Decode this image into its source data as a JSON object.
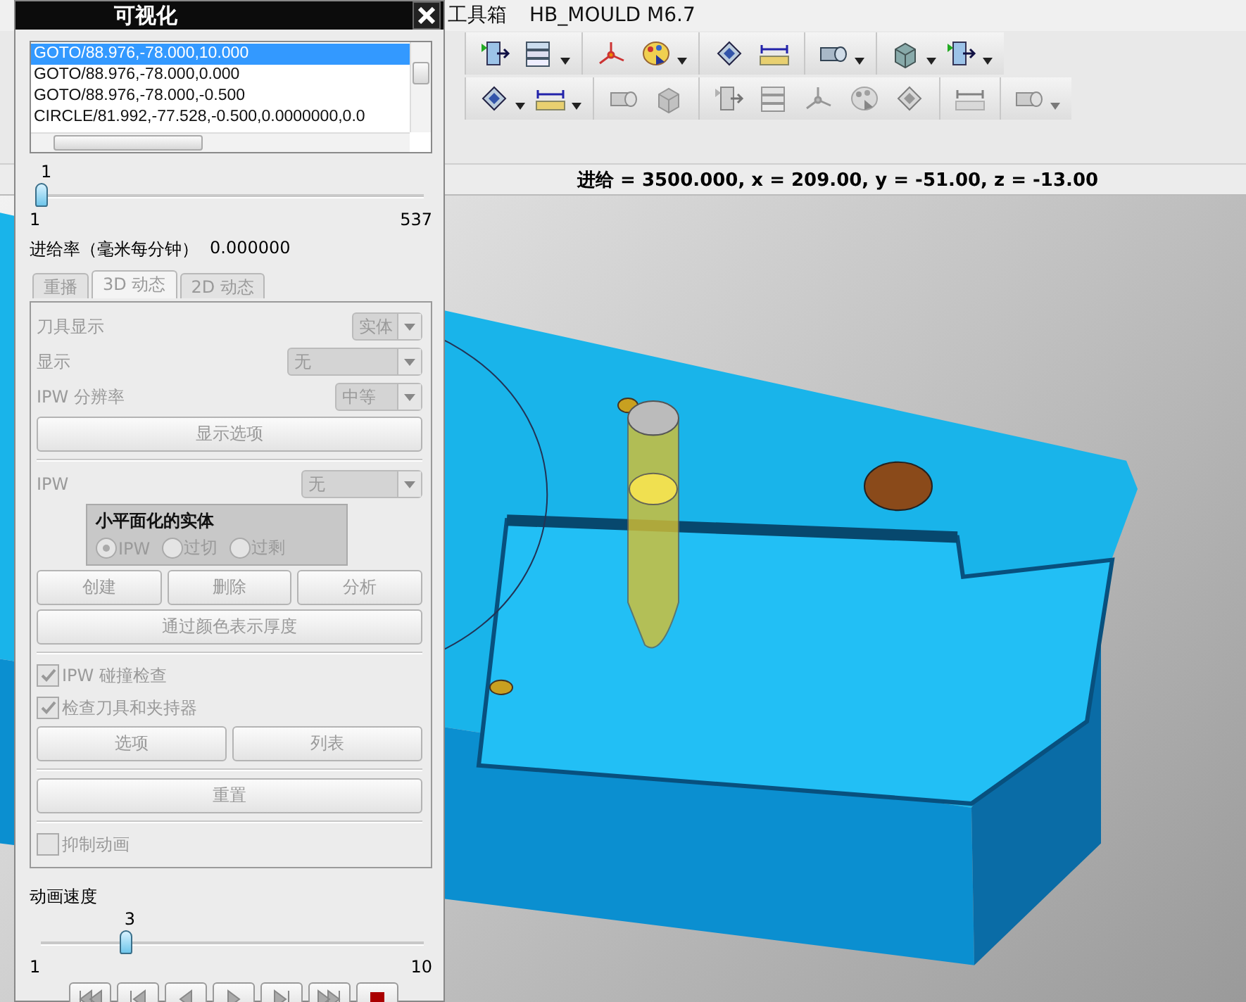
{
  "menu_bar": {
    "items": [
      "工具箱",
      "HB_MOULD M6.7"
    ]
  },
  "toolbars": [
    {
      "groups": [
        [
          {
            "disabled": false,
            "dropdown": false
          },
          {
            "disabled": false,
            "dropdown": true
          }
        ],
        [
          {
            "disabled": false,
            "dropdown": false
          },
          {
            "disabled": false,
            "dropdown": true
          }
        ],
        [
          {
            "disabled": false,
            "dropdown": false
          },
          {
            "disabled": false,
            "dropdown": false
          }
        ],
        [
          {
            "disabled": false,
            "dropdown": true
          }
        ],
        [
          {
            "disabled": false,
            "dropdown": true
          },
          {
            "disabled": false,
            "dropdown": true
          }
        ]
      ]
    },
    {
      "groups": [
        [
          {
            "disabled": false,
            "dropdown": true
          },
          {
            "disabled": false,
            "dropdown": true
          }
        ],
        [
          {
            "disabled": true,
            "dropdown": false
          },
          {
            "disabled": true,
            "dropdown": false
          }
        ],
        [
          {
            "disabled": true,
            "dropdown": false
          },
          {
            "disabled": true,
            "dropdown": false
          },
          {
            "disabled": true,
            "dropdown": false
          },
          {
            "disabled": true,
            "dropdown": false
          },
          {
            "disabled": true,
            "dropdown": false
          }
        ],
        [
          {
            "disabled": true,
            "dropdown": false
          }
        ],
        [
          {
            "disabled": true,
            "dropdown": true
          }
        ]
      ]
    }
  ],
  "status_bar": {
    "text": "进给 = 3500.000, x = 209.00, y = -51.00, z = -13.00"
  },
  "dialog": {
    "title": "可视化",
    "path_list": [
      {
        "text": "GOTO/88.976,-78.000,10.000",
        "selected": true
      },
      {
        "text": "GOTO/88.976,-78.000,0.000",
        "selected": false
      },
      {
        "text": "GOTO/88.976,-78.000,-0.500",
        "selected": false
      },
      {
        "text": "CIRCLE/81.992,-77.528,-0.500,0.0000000,0.0",
        "selected": false
      }
    ],
    "step_slider": {
      "value": "1",
      "min": "1",
      "max": "537",
      "level": 0
    },
    "feed_rate": {
      "label": "进给率（毫米每分钟）",
      "value": "0.000000"
    },
    "tabs": [
      {
        "label": "重播",
        "selected": false
      },
      {
        "label": "3D 动态",
        "selected": true
      },
      {
        "label": "2D 动态",
        "selected": false
      }
    ],
    "panel": {
      "disabled": true,
      "dropdowns": [
        {
          "label": "刀具显示",
          "value": "实体"
        },
        {
          "label": "显示",
          "value": "无"
        },
        {
          "label": "IPW 分辨率",
          "value": "中等"
        }
      ],
      "display_options_button": "显示选项",
      "ipw": {
        "label": "IPW",
        "value": "无"
      },
      "facet_group": {
        "title": "小平面化的实体",
        "options": [
          {
            "label": "IPW",
            "selected": true
          },
          {
            "label": "过切",
            "selected": false
          },
          {
            "label": "过剩",
            "selected": false
          }
        ]
      },
      "ipw_buttons": [
        "创建",
        "删除",
        "分析"
      ],
      "thickness_button": "通过颜色表示厚度",
      "checks": [
        {
          "label": "IPW 碰撞检查",
          "checked": true
        },
        {
          "label": "检查刀具和夹持器",
          "checked": true
        }
      ],
      "option_buttons": [
        "选项",
        "列表"
      ],
      "reset_button": "重置",
      "suppress_animation": {
        "label": "抑制动画",
        "checked": false
      }
    },
    "speed": {
      "label": "动画速度",
      "value": "3",
      "min": "1",
      "max": "10",
      "level": 0.22
    }
  }
}
